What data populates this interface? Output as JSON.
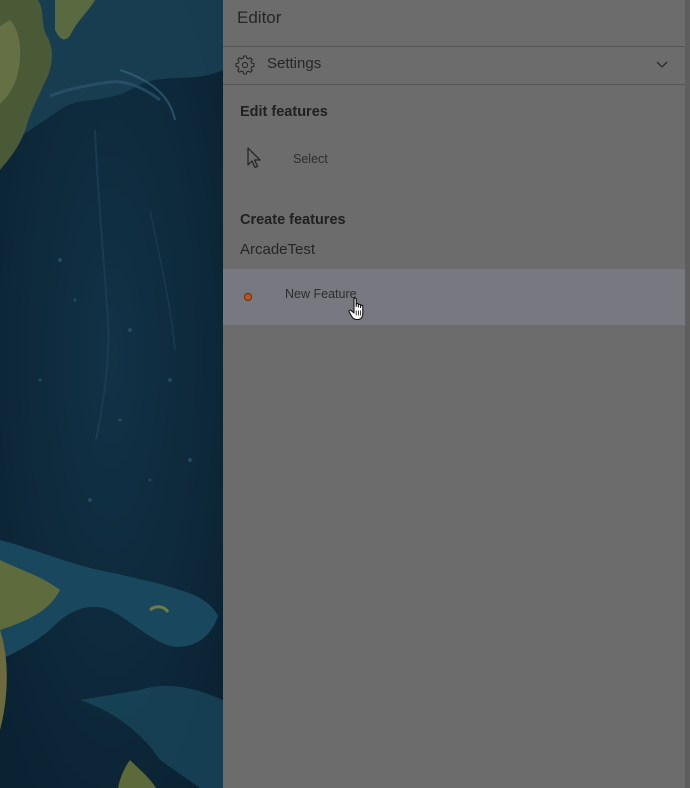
{
  "colors": {
    "panel_bg": "#6c6c6c",
    "map_ocean": "#0e2a3c",
    "hover_row": "#777880",
    "point_symbol": "#c0521f"
  },
  "map": {
    "icon": "basemap-imagery"
  },
  "editor": {
    "title": "Editor",
    "settings": {
      "label": "Settings",
      "icon": "gear-icon",
      "expand_icon": "chevron-down-icon"
    },
    "edit_features": {
      "heading": "Edit features",
      "tools": [
        {
          "label": "Select",
          "icon": "pointer-cursor-icon"
        }
      ]
    },
    "create_features": {
      "heading": "Create features",
      "layer": "ArcadeTest",
      "templates": [
        {
          "label": "New Feature",
          "icon": "point-symbol-icon"
        }
      ]
    }
  },
  "mouse_cursor": {
    "icon": "hand-pointer-icon"
  }
}
